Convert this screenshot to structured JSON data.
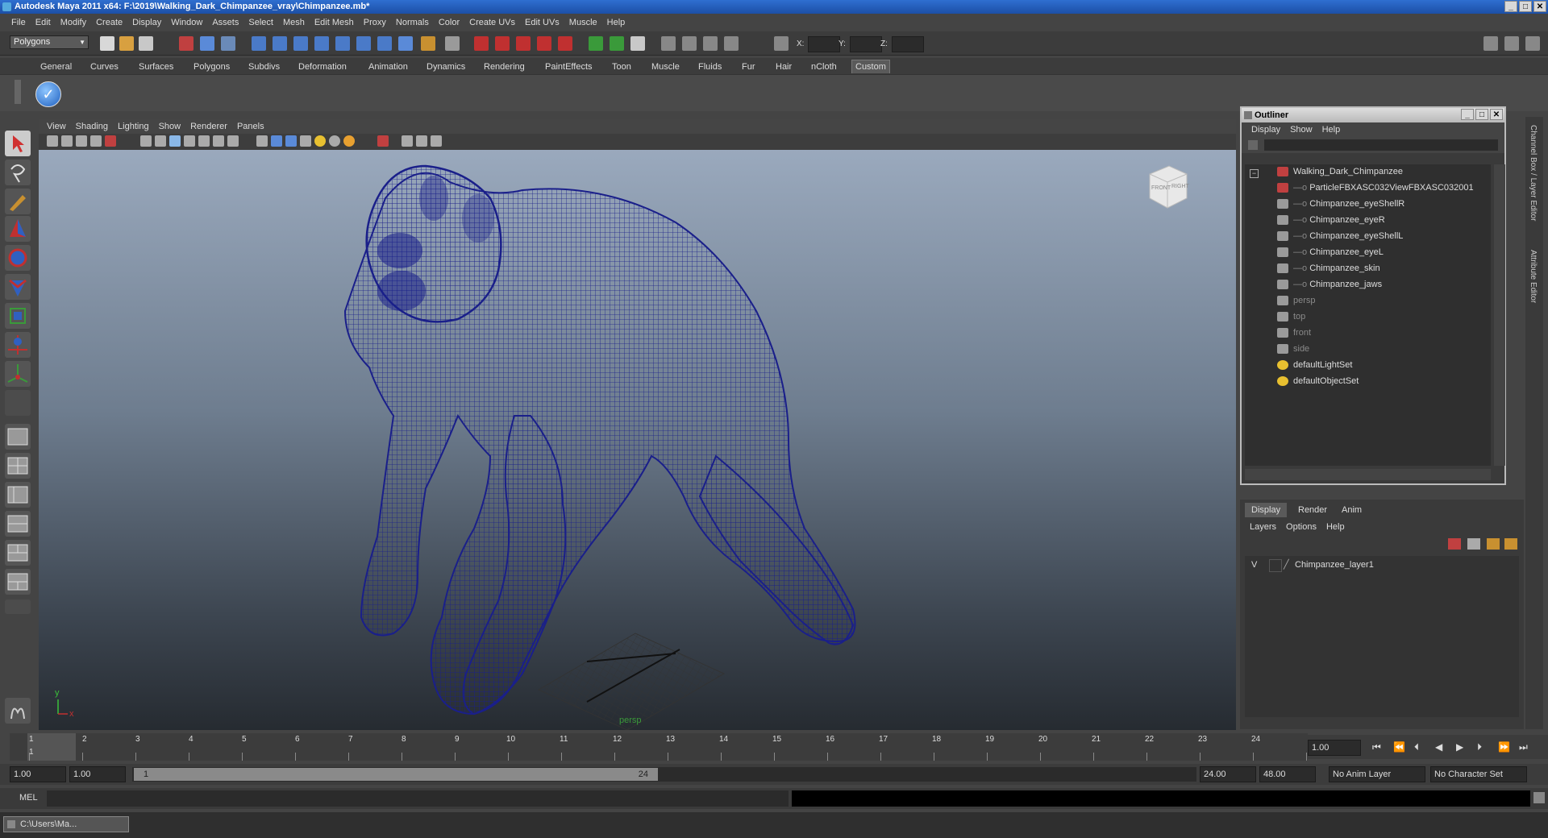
{
  "window": {
    "title": "Autodesk Maya 2011 x64: F:\\2019\\Walking_Dark_Chimpanzee_vray\\Chimpanzee.mb*",
    "minimize": "_",
    "maximize": "□",
    "close": "✕"
  },
  "menubar": [
    "File",
    "Edit",
    "Modify",
    "Create",
    "Display",
    "Window",
    "Assets",
    "Select",
    "Mesh",
    "Edit Mesh",
    "Proxy",
    "Normals",
    "Color",
    "Create UVs",
    "Edit UVs",
    "Muscle",
    "Help"
  ],
  "toolbar": {
    "mode": "Polygons",
    "x_label": "X:",
    "y_label": "Y:",
    "z_label": "Z:"
  },
  "shelf_tabs": [
    "General",
    "Curves",
    "Surfaces",
    "Polygons",
    "Subdivs",
    "Deformation",
    "Animation",
    "Dynamics",
    "Rendering",
    "PaintEffects",
    "Toon",
    "Muscle",
    "Fluids",
    "Fur",
    "Hair",
    "nCloth",
    "Custom"
  ],
  "active_shelf": "Custom",
  "viewport": {
    "menu": [
      "View",
      "Shading",
      "Lighting",
      "Show",
      "Renderer",
      "Panels"
    ],
    "camera_label": "persp",
    "cube_front": "FRONT",
    "cube_right": "RIGHT",
    "axis_y": "y",
    "axis_x": "x",
    "wire_color": "#1a1f8a"
  },
  "outliner": {
    "title": "Outliner",
    "menu": [
      "Display",
      "Show",
      "Help"
    ],
    "items": [
      {
        "label": "Walking_Dark_Chimpanzee",
        "indent": 0,
        "dim": false,
        "icon": "transform-icon",
        "collapse": "−"
      },
      {
        "label": "ParticleFBXASC032ViewFBXASC032001",
        "indent": 1,
        "dim": false,
        "icon": "transform-icon"
      },
      {
        "label": "Chimpanzee_eyeShellR",
        "indent": 1,
        "dim": false,
        "icon": "mesh-icon"
      },
      {
        "label": "Chimpanzee_eyeR",
        "indent": 1,
        "dim": false,
        "icon": "mesh-icon"
      },
      {
        "label": "Chimpanzee_eyeShellL",
        "indent": 1,
        "dim": false,
        "icon": "mesh-icon"
      },
      {
        "label": "Chimpanzee_eyeL",
        "indent": 1,
        "dim": false,
        "icon": "mesh-icon"
      },
      {
        "label": "Chimpanzee_skin",
        "indent": 1,
        "dim": false,
        "icon": "mesh-icon"
      },
      {
        "label": "Chimpanzee_jaws",
        "indent": 1,
        "dim": false,
        "icon": "mesh-icon"
      },
      {
        "label": "persp",
        "indent": 0,
        "dim": true,
        "icon": "camera-icon"
      },
      {
        "label": "top",
        "indent": 0,
        "dim": true,
        "icon": "camera-icon"
      },
      {
        "label": "front",
        "indent": 0,
        "dim": true,
        "icon": "camera-icon"
      },
      {
        "label": "side",
        "indent": 0,
        "dim": true,
        "icon": "camera-icon"
      },
      {
        "label": "defaultLightSet",
        "indent": 0,
        "dim": false,
        "icon": "set-icon"
      },
      {
        "label": "defaultObjectSet",
        "indent": 0,
        "dim": false,
        "icon": "set-icon"
      }
    ]
  },
  "right_strip": {
    "channel_box": "Channel Box / Layer Editor",
    "attribute_editor": "Attribute Editor"
  },
  "layers": {
    "tabs": [
      "Display",
      "Render",
      "Anim"
    ],
    "active_tab": "Display",
    "menu": [
      "Layers",
      "Options",
      "Help"
    ],
    "rows": [
      {
        "visible": "V",
        "name": "Chimpanzee_layer1"
      }
    ]
  },
  "timeline": {
    "ticks": [
      "1",
      "2",
      "3",
      "4",
      "5",
      "6",
      "7",
      "8",
      "9",
      "10",
      "11",
      "12",
      "13",
      "14",
      "15",
      "16",
      "17",
      "18",
      "19",
      "20",
      "21",
      "22",
      "23",
      "24"
    ],
    "current_frame_marker": "1",
    "current_time": "1.00"
  },
  "range": {
    "start_time": "1.00",
    "playback_start": "1.00",
    "range_start_label": "1",
    "range_end_label": "24",
    "playback_end": "24.00",
    "end_time": "48.00",
    "anim_layer": "No Anim Layer",
    "character_set": "No Character Set"
  },
  "command_line": {
    "label": "MEL"
  },
  "taskbar": {
    "item": "C:\\Users\\Ma..."
  }
}
